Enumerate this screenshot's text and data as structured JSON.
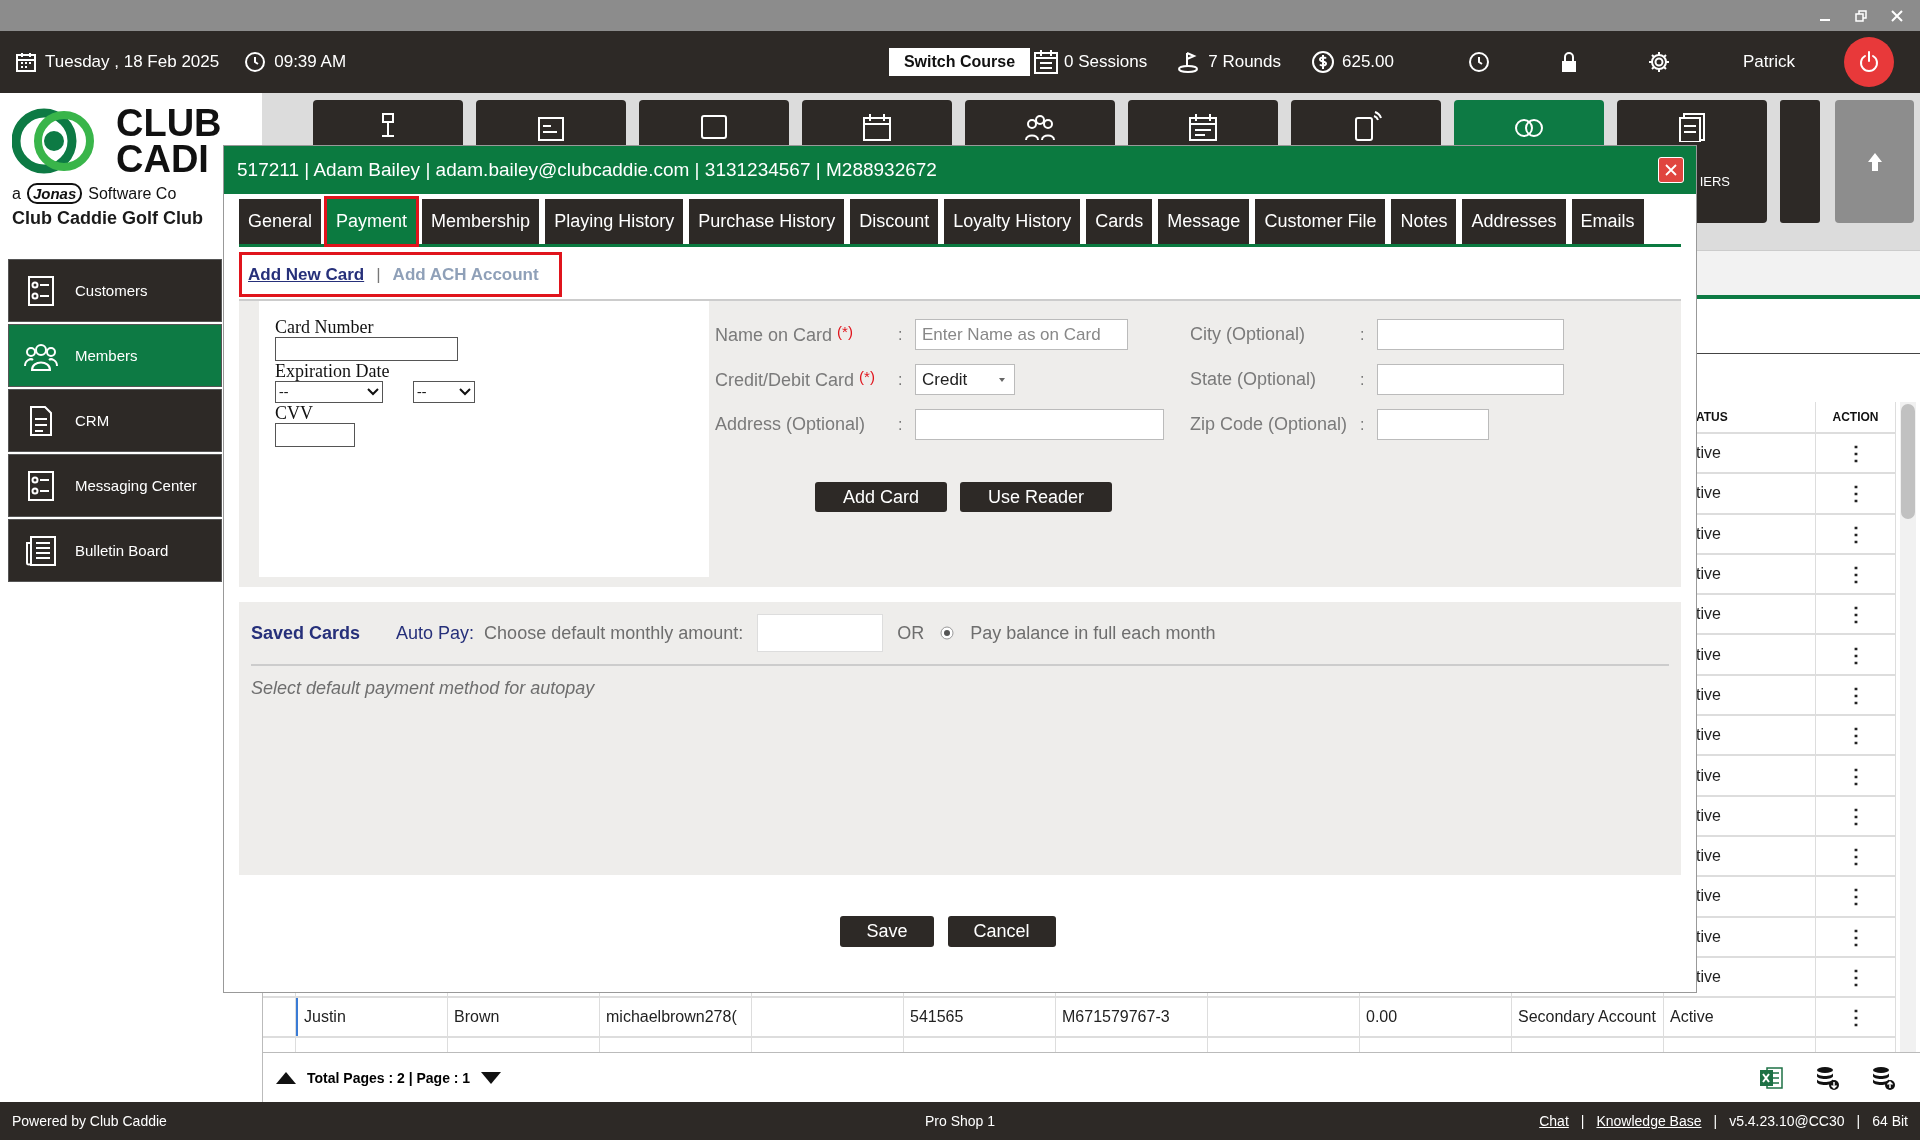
{
  "top_bar": {
    "date": "Tuesday ,  18 Feb 2025",
    "time": "09:39 AM",
    "switch_course": "Switch Course",
    "sessions": "0 Sessions",
    "rounds": "7 Rounds",
    "balance": "625.00",
    "user": "Patrick"
  },
  "logo": {
    "line_1": "CLUB",
    "line_2": "CADI",
    "prefix": "a",
    "brand": "Jonas",
    "suffix": "Software Co",
    "club_name": "Club Caddie Golf Club"
  },
  "tiles": [
    {
      "selected": false
    },
    {
      "selected": false
    },
    {
      "selected": false
    },
    {
      "selected": false
    },
    {
      "selected": false
    },
    {
      "selected": false
    },
    {
      "selected": false
    },
    {
      "selected": true
    },
    {
      "selected": false,
      "label": "IERS"
    }
  ],
  "sidebar": {
    "items": [
      {
        "label": "Customers",
        "selected": false
      },
      {
        "label": "Members",
        "selected": true
      },
      {
        "label": "CRM",
        "selected": false
      },
      {
        "label": "Messaging Center",
        "selected": false
      },
      {
        "label": "Bulletin Board",
        "selected": false
      }
    ]
  },
  "table": {
    "header": {
      "status": "ATUS",
      "action": "ACTION"
    },
    "covered_rows": [
      {
        "status": "tive",
        "action": "⋮"
      },
      {
        "status": "tive",
        "action": "⋮"
      },
      {
        "status": "tive",
        "action": "⋮"
      },
      {
        "status": "tive",
        "action": "⋮"
      },
      {
        "status": "tive",
        "action": "⋮"
      },
      {
        "status": "tive",
        "action": "⋮"
      },
      {
        "status": "tive",
        "action": "⋮"
      },
      {
        "status": "tive",
        "action": "⋮"
      },
      {
        "status": "tive",
        "action": "⋮"
      },
      {
        "status": "tive",
        "action": "⋮"
      },
      {
        "status": "tive",
        "action": "⋮"
      },
      {
        "status": "tive",
        "action": "⋮"
      },
      {
        "status": "tive",
        "action": "⋮"
      },
      {
        "status": "tive",
        "action": "⋮"
      }
    ],
    "rows": [
      {
        "column_1": "Justin",
        "column_2": "Brown",
        "column_3": "michaelbrown278(",
        "column_5": "541565",
        "column_6": "M671579767-3",
        "column_8": "0.00",
        "column_9": "Secondary Account",
        "status": "Active",
        "action": "⋮"
      }
    ]
  },
  "pagination": {
    "summary": "Total Pages : 2 | Page : 1"
  },
  "status_bar": {
    "left": "Powered by Club Caddie",
    "center": "Pro Shop 1",
    "right": [
      {
        "kind": "link",
        "text": "Chat"
      },
      {
        "kind": "separator",
        "text": "|"
      },
      {
        "kind": "link",
        "text": "Knowledge Base"
      },
      {
        "kind": "separator",
        "text": "|"
      },
      {
        "kind": "text",
        "text": "v5.4.23.10@CC30"
      },
      {
        "kind": "separator",
        "text": "|"
      },
      {
        "kind": "text",
        "text": "64 Bit"
      }
    ]
  },
  "modal": {
    "title": "517211 | Adam Bailey | adam.bailey@clubcaddie.com | 3131234567 | M288932672",
    "tabs": [
      {
        "label": "General",
        "selected": false,
        "highlighted": false
      },
      {
        "label": "Payment",
        "selected": true,
        "highlighted": true
      },
      {
        "label": "Membership",
        "selected": false,
        "highlighted": false
      },
      {
        "label": "Playing History",
        "selected": false,
        "highlighted": false
      },
      {
        "label": "Purchase History",
        "selected": false,
        "highlighted": false
      },
      {
        "label": "Discount",
        "selected": false,
        "highlighted": false
      },
      {
        "label": "Loyalty History",
        "selected": false,
        "highlighted": false
      },
      {
        "label": "Cards",
        "selected": false,
        "highlighted": false
      },
      {
        "label": "Message",
        "selected": false,
        "highlighted": false
      },
      {
        "label": "Customer File",
        "selected": false,
        "highlighted": false
      },
      {
        "label": "Notes",
        "selected": false,
        "highlighted": false
      },
      {
        "label": "Addresses",
        "selected": false,
        "highlighted": false
      },
      {
        "label": "Emails",
        "selected": false,
        "highlighted": false
      }
    ],
    "subtabs": {
      "highlighted": true,
      "items": [
        {
          "kind": "tab",
          "label": "Add New Card",
          "selected": true
        },
        {
          "kind": "separator",
          "label": "|"
        },
        {
          "kind": "tab",
          "label": "Add ACH Account",
          "selected": false
        }
      ]
    },
    "card_panel": [
      {
        "kind": "text",
        "label": "Card Number"
      },
      {
        "kind": "expiry",
        "label": "Expiration Date",
        "month": "--",
        "year": "--"
      },
      {
        "kind": "cvv",
        "label": "CVV"
      }
    ],
    "details_left": [
      {
        "kind": "input",
        "label": "Name on Card",
        "required": "(*)",
        "colon": ":",
        "placeholder": "Enter Name as on Card"
      },
      {
        "kind": "select",
        "label": "Credit/Debit Card",
        "required": "(*)",
        "colon": ":",
        "value": "Credit"
      },
      {
        "kind": "input",
        "label": "Address (Optional)",
        "colon": ":"
      }
    ],
    "details_right": [
      {
        "kind": "input",
        "label": "City (Optional)",
        "colon": ":"
      },
      {
        "kind": "input",
        "label": "State (Optional)",
        "colon": ":"
      },
      {
        "kind": "short",
        "label": "Zip Code (Optional)",
        "colon": ":"
      }
    ],
    "card_buttons": [
      "Add Card",
      "Use Reader"
    ],
    "saved_cards": {
      "title": "Saved Cards",
      "autopay_label": "Auto Pay:",
      "amount_label": "Choose default monthly amount:",
      "or": "OR",
      "full_balance": {
        "label": "Pay balance in full each month",
        "selected": true
      },
      "hint": "Select default payment method for autopay"
    },
    "buttons": [
      "Save",
      "Cancel"
    ]
  }
}
